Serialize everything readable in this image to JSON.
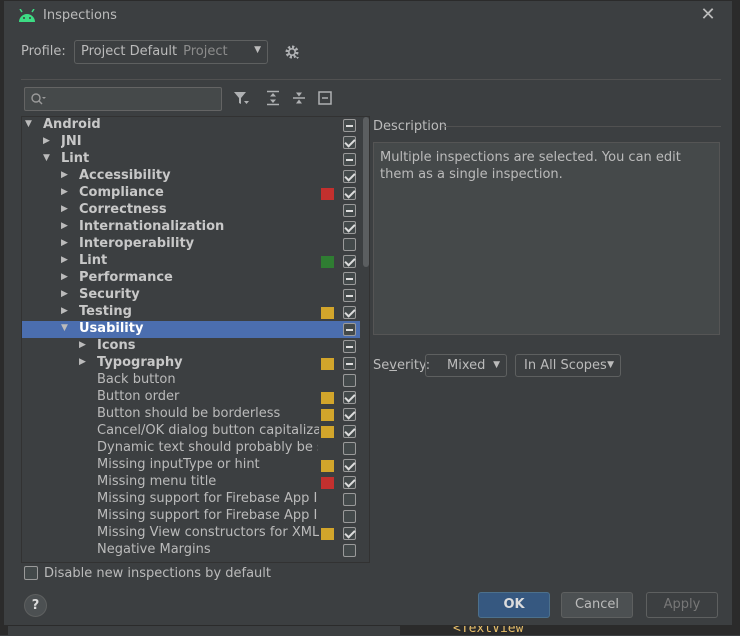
{
  "window": {
    "title": "Inspections",
    "close_glyph": "✕"
  },
  "profile": {
    "label": "Profile:",
    "value": "Project Default",
    "hint": "Project"
  },
  "search": {
    "placeholder": ""
  },
  "tree": {
    "rows": [
      {
        "label": "Android",
        "arrow": "▼",
        "bold": true,
        "check": "mixed"
      },
      {
        "label": "JNI",
        "arrow": "▶",
        "bold": true,
        "check": "checked"
      },
      {
        "label": "Lint",
        "arrow": "▼",
        "bold": true,
        "check": "mixed"
      },
      {
        "label": "Accessibility",
        "arrow": "▶",
        "bold": true,
        "check": "checked"
      },
      {
        "label": "Compliance",
        "arrow": "▶",
        "bold": true,
        "check": "checked",
        "severity": "#c3302e"
      },
      {
        "label": "Correctness",
        "arrow": "▶",
        "bold": true,
        "check": "mixed"
      },
      {
        "label": "Internationalization",
        "arrow": "▶",
        "bold": true,
        "check": "checked"
      },
      {
        "label": "Interoperability",
        "arrow": "▶",
        "bold": true,
        "check": "unchecked"
      },
      {
        "label": "Lint",
        "arrow": "▶",
        "bold": true,
        "check": "checked",
        "severity": "#2f7d32"
      },
      {
        "label": "Performance",
        "arrow": "▶",
        "bold": true,
        "check": "mixed"
      },
      {
        "label": "Security",
        "arrow": "▶",
        "bold": true,
        "check": "mixed"
      },
      {
        "label": "Testing",
        "arrow": "▶",
        "bold": true,
        "check": "checked",
        "severity": "#d2a52b"
      },
      {
        "label": "Usability",
        "arrow": "▼",
        "bold": true,
        "check": "mixed",
        "selected": true
      },
      {
        "label": "Icons",
        "arrow": "▶",
        "bold": true,
        "check": "mixed"
      },
      {
        "label": "Typography",
        "arrow": "▶",
        "bold": true,
        "check": "mixed",
        "severity": "#d2a52b"
      },
      {
        "label": "Back button",
        "check": "unchecked"
      },
      {
        "label": "Button order",
        "check": "checked",
        "severity": "#d2a52b"
      },
      {
        "label": "Button should be borderless",
        "check": "checked",
        "severity": "#d2a52b"
      },
      {
        "label": "Cancel/OK dialog button capitalization",
        "check": "checked",
        "severity": "#d2a52b"
      },
      {
        "label": "Dynamic text should probably be selectable",
        "check": "unchecked"
      },
      {
        "label": "Missing inputType or hint",
        "check": "checked",
        "severity": "#d2a52b"
      },
      {
        "label": "Missing menu title",
        "check": "checked",
        "severity": "#c3302e"
      },
      {
        "label": "Missing support for Firebase App Indexing",
        "check": "unchecked"
      },
      {
        "label": "Missing support for Firebase App Indexing API",
        "check": "unchecked"
      },
      {
        "label": "Missing View constructors for XML inflation",
        "check": "checked",
        "severity": "#d2a52b"
      },
      {
        "label": "Negative Margins",
        "check": "unchecked"
      }
    ]
  },
  "description": {
    "label": "Description",
    "text": "Multiple inspections are selected. You can edit them as a single inspection."
  },
  "severity": {
    "label_prefix": "Se",
    "label_underlined": "v",
    "label_suffix": "erity:",
    "value": "Mixed",
    "scope": "In All Scopes"
  },
  "options": {
    "disable_new_label": "Disable new inspections by default"
  },
  "buttons": {
    "help": "?",
    "ok": "OK",
    "cancel": "Cancel",
    "apply": "Apply"
  },
  "colors": {
    "selection": "#4b6eaf",
    "ok_button": "#365880",
    "error": "#c3302e",
    "warning": "#d2a52b",
    "info": "#2f7d32",
    "android_green": "#3ddc84"
  },
  "background": {
    "editor_snippet": "<TextView"
  }
}
